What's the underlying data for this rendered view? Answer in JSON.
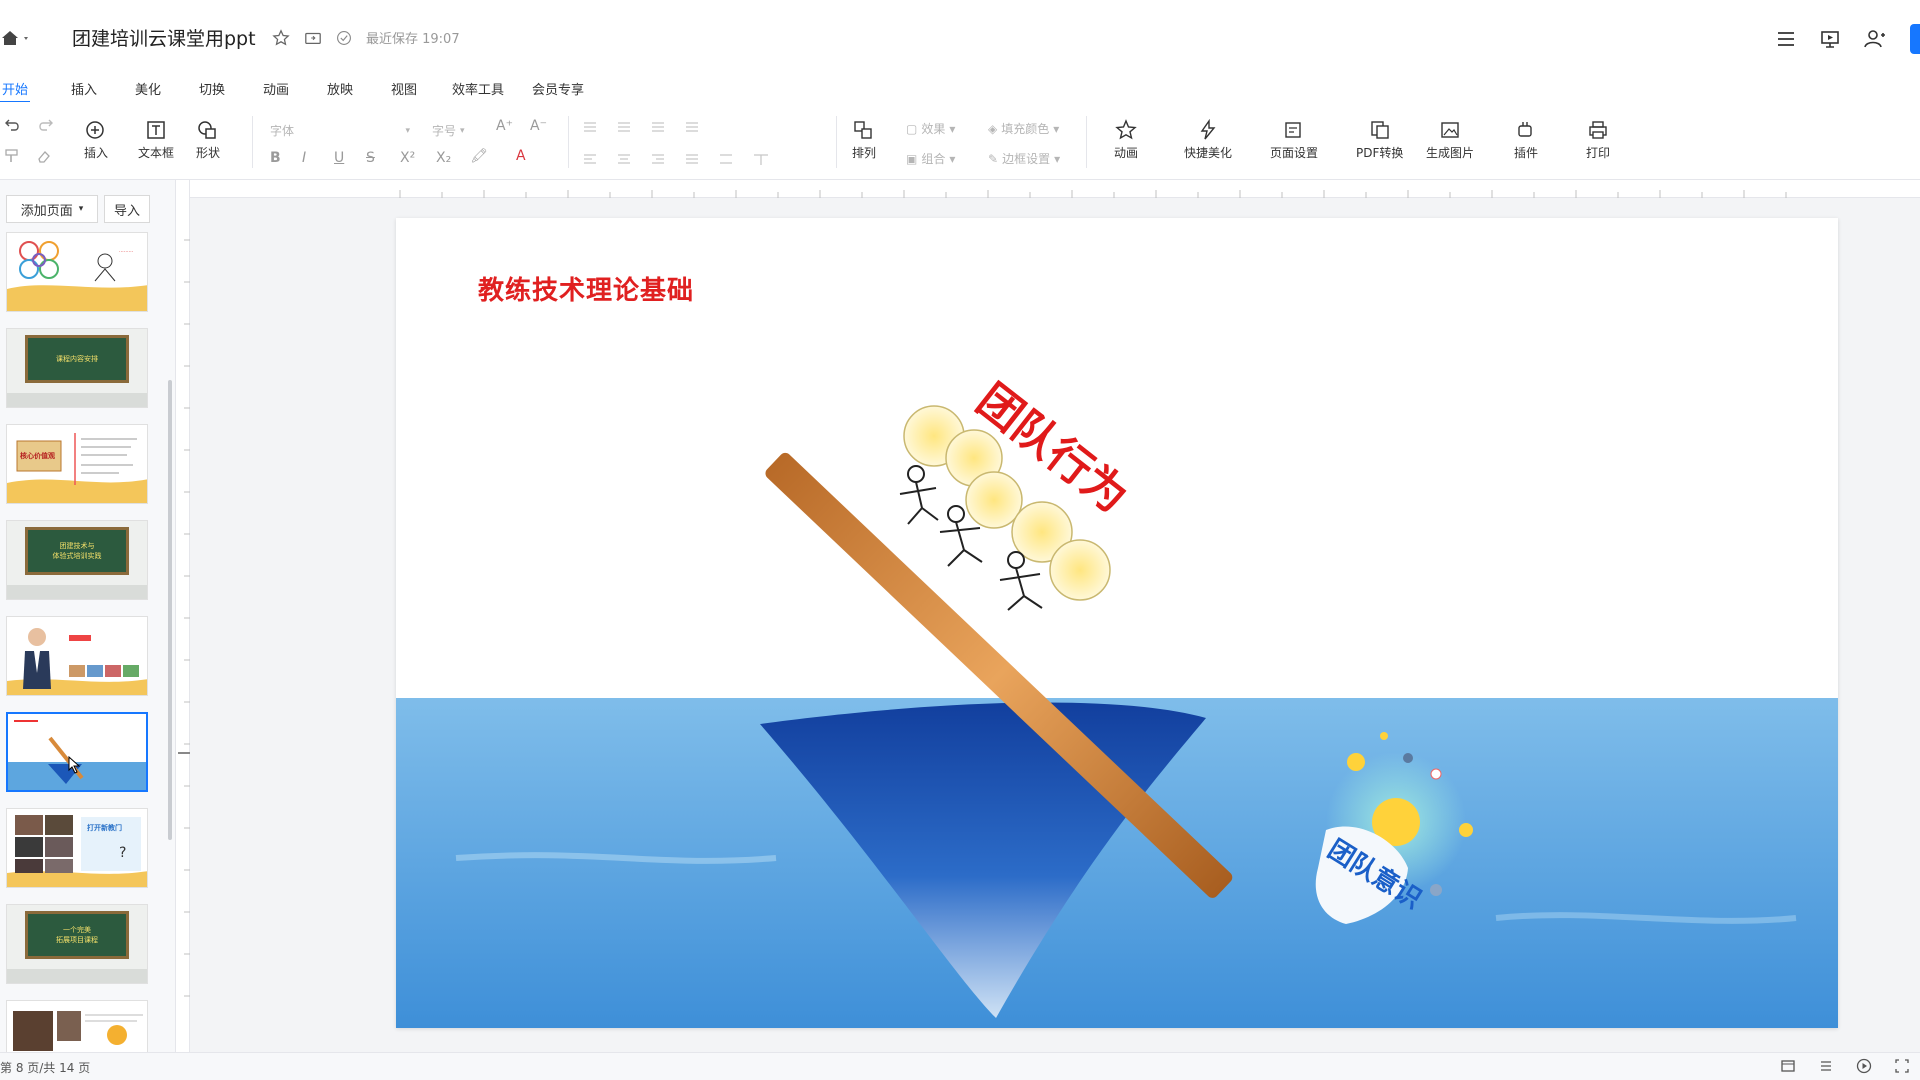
{
  "header": {
    "doc_title": "团建培训云课堂用ppt",
    "save_status": "最近保存 19:07"
  },
  "menu": {
    "tabs": [
      "开始",
      "插入",
      "美化",
      "切换",
      "动画",
      "放映",
      "视图",
      "效率工具",
      "会员专享"
    ],
    "active_tab": "开始"
  },
  "toolbar": {
    "insert": "插入",
    "textbox": "文本框",
    "shape": "形状",
    "font_placeholder": "字体",
    "size_placeholder": "字号",
    "effect": "效果",
    "fill_color": "填充颜色",
    "combine": "组合",
    "border": "边框设置",
    "arrange": "排列",
    "animation": "动画",
    "quick_beautify": "快捷美化",
    "page_setup": "页面设置",
    "pdf_convert": "PDF转换",
    "gen_image": "生成图片",
    "plugin": "插件",
    "print": "打印"
  },
  "sidebar": {
    "add_page": "添加页面",
    "import": "导入",
    "board_text_1": "课程内容安排",
    "board_text_2a": "团建技术与",
    "board_text_2b": "体验式培训实践",
    "board_text_3a": "一个完美",
    "board_text_3b": "拓展项目课程",
    "thumb_3_text": "核心价值观",
    "thumb_7_text": "打开新教门",
    "active_index": 5
  },
  "slide": {
    "title": "教练技术理论基础",
    "upper_label": "团队行为",
    "lower_label": "团队意识"
  },
  "status": {
    "page_info": "第 8 页/共 14 页"
  },
  "colors": {
    "accent": "#1677ff",
    "title_red": "#e02020",
    "sea_top": "#6fb3e6",
    "sea_bottom": "#3d8fd9",
    "iceberg": "#1b57b8"
  }
}
